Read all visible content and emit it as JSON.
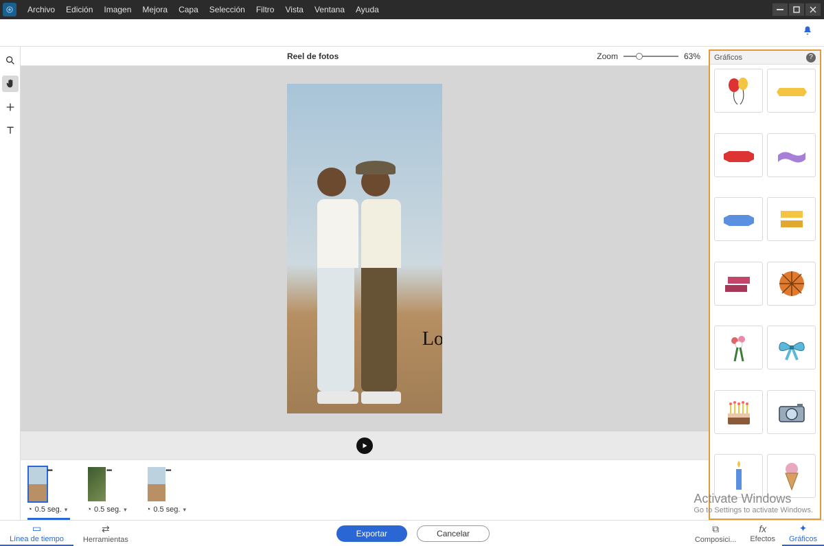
{
  "menu": {
    "items": [
      "Archivo",
      "Edición",
      "Imagen",
      "Mejora",
      "Capa",
      "Selección",
      "Filtro",
      "Vista",
      "Ventana",
      "Ayuda"
    ]
  },
  "canvas": {
    "title": "Reel de fotos",
    "zoom_label": "Zoom",
    "zoom_value": "63%",
    "overlay_text": "Lo"
  },
  "timeline_clips": {
    "duration": "0.5 seg."
  },
  "rightpanel": {
    "title": "Gráficos",
    "stickers": [
      "balloons",
      "ribbon-yellow",
      "ribbon-red",
      "ribbon-purple",
      "ribbon-blue",
      "ribbon-gold-folded",
      "ribbon-pink-folded",
      "basketball",
      "bouquet",
      "bow-blue",
      "birthday-cake",
      "camera",
      "candle",
      "ice-cream-cone"
    ]
  },
  "bottombar": {
    "left_tabs": {
      "timeline": "Línea de tiempo",
      "tools": "Herramientas"
    },
    "export": "Exportar",
    "cancel": "Cancelar",
    "right_tabs": {
      "compose": "Composici...",
      "effects": "Efectos",
      "graphics": "Gráficos"
    }
  },
  "watermark": {
    "title": "Activate Windows",
    "sub": "Go to Settings to activate Windows."
  }
}
